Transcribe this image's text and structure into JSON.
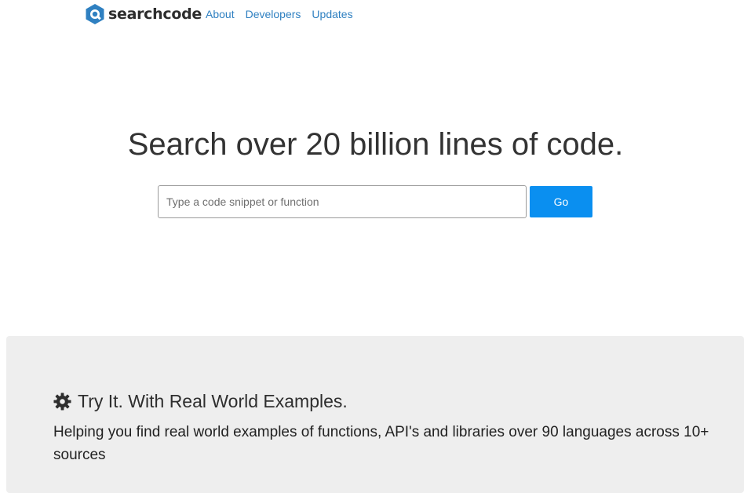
{
  "brand": {
    "name": "searchcode",
    "logo_icon": "searchcode-hexagon-logo-icon",
    "logo_color": "#2f80c1"
  },
  "nav": {
    "items": [
      {
        "label": "About"
      },
      {
        "label": "Developers"
      },
      {
        "label": "Updates"
      }
    ],
    "link_color": "#2f80c1"
  },
  "hero": {
    "title": "Search over 20 billion lines of code."
  },
  "search": {
    "placeholder": "Type a code snippet or function",
    "value": "",
    "button_label": "Go",
    "button_color": "#0a8ff0"
  },
  "examples_panel": {
    "icon": "gear-icon",
    "title": "Try It. With Real World Examples.",
    "description": "Helping you find real world examples of functions, API's and libraries over 90 languages across 10+ sources",
    "background": "#eeeeee"
  }
}
